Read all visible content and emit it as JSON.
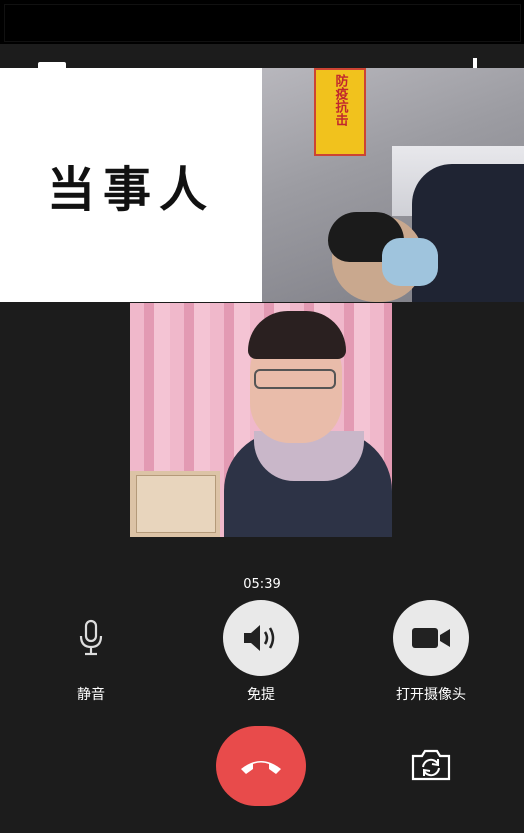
{
  "call": {
    "label_tile_text": "当事人",
    "timer": "05:39"
  },
  "controls": {
    "mute_label": "静音",
    "speaker_label": "免提",
    "camera_label": "打开摄像头"
  },
  "icons": {
    "add": "plus-icon",
    "mute": "microphone-icon",
    "speaker": "speaker-icon",
    "camera": "video-camera-icon",
    "hangup": "phone-hangup-icon",
    "switch_camera": "switch-camera-icon"
  },
  "colors": {
    "background": "#1c1c1c",
    "hangup": "#e84b4b",
    "button_fill": "#e9e9e9"
  },
  "remote_video": {
    "sign_text": "防疫抗击"
  }
}
